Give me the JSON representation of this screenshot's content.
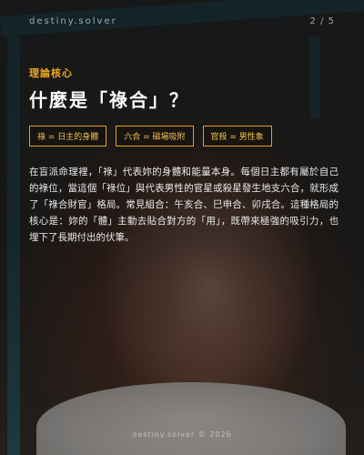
{
  "header": {
    "brand": "destiny.solver",
    "page": "2 / 5"
  },
  "section_label": "理論核心",
  "title": "什麼是「祿合」？",
  "tags": [
    "祿 = 日主的身體",
    "六合 = 磁場吸附",
    "官殺 = 男性象"
  ],
  "body": "在盲派命理裡，「祿」代表妳的身體和能量本身。每個日主都有屬於自己的祿位，當這個「祿位」與代表男性的官星或殺星發生地支六合，就形成了「祿合財官」格局。常見組合：午亥合、巳申合、卯戌合。這種格局的核心是：妳的「體」主動去貼合對方的「用」，既帶來極強的吸引力，也埋下了長期付出的伏筆。",
  "footer": "destiny.solver © 2026",
  "colors": {
    "accent": "#f0a81c",
    "tag_border": "#e8a01a",
    "text": "#ffffff",
    "teal": "#1c7896"
  }
}
